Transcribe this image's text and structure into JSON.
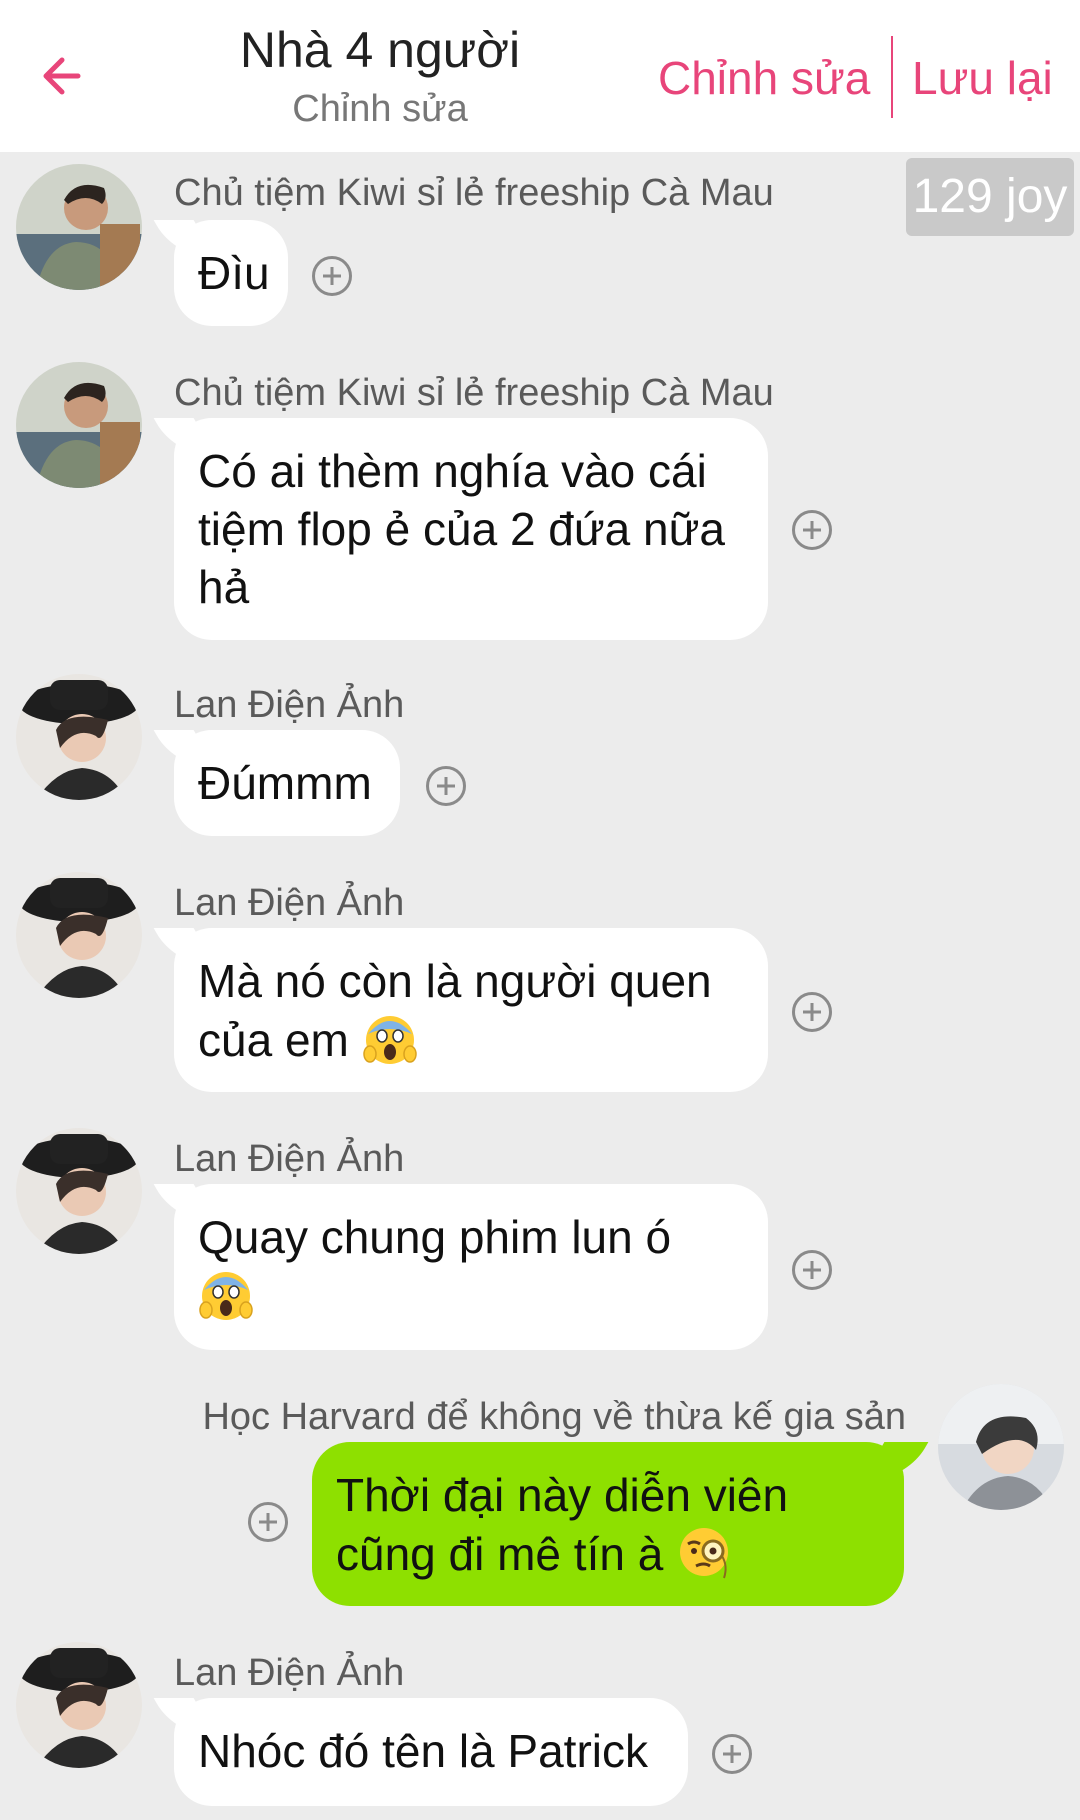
{
  "header": {
    "title": "Nhà 4 người",
    "subtitle": "Chỉnh sửa",
    "edit_label": "Chỉnh sửa",
    "save_label": "Lưu lại"
  },
  "joy_badge": "129 joy",
  "colors": {
    "accent": "#e8457a",
    "own_bubble": "#8ee000",
    "other_bubble": "#ffffff",
    "background": "#ececec"
  },
  "messages": [
    {
      "sender": "Chủ tiệm Kiwi sỉ lẻ freeship Cà Mau",
      "lines": [
        "Đìu"
      ],
      "side": "left"
    },
    {
      "sender": "Chủ tiệm Kiwi sỉ lẻ freeship Cà Mau",
      "lines": [
        "Có ai thèm nghía vào cái",
        "tiệm flop ẻ của 2 đứa nữa",
        "hả"
      ],
      "side": "left"
    },
    {
      "sender": "Lan Điện Ảnh",
      "lines": [
        "Đúmmm"
      ],
      "side": "left"
    },
    {
      "sender": "Lan Điện Ảnh",
      "lines": [
        "Mà nó còn là người quen",
        "của em"
      ],
      "emoji": "scream-emoji",
      "side": "left"
    },
    {
      "sender": "Lan Điện Ảnh",
      "lines": [
        "Quay chung phim lun ó"
      ],
      "emoji": "scream-emoji",
      "side": "left"
    },
    {
      "sender": "Học Harvard để không về thừa kế gia sản",
      "lines": [
        "Thời đại này diễn viên",
        "cũng đi mê tín à"
      ],
      "emoji": "monocle-emoji",
      "side": "right"
    },
    {
      "sender": "Lan Điện Ảnh",
      "lines": [
        "Nhóc đó tên là Patrick"
      ],
      "side": "left"
    }
  ]
}
